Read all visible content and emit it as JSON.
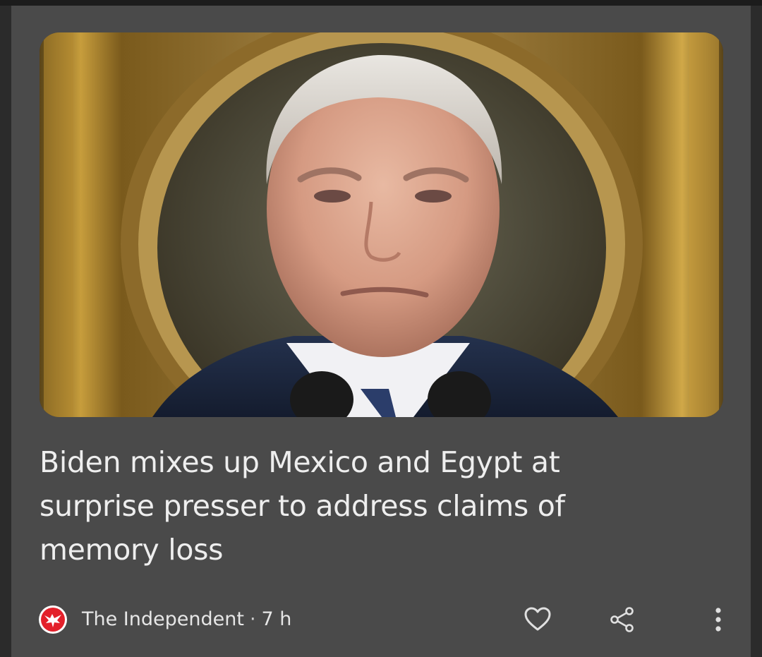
{
  "article": {
    "headline": "Biden mixes up Mexico and Egypt at surprise presser to address claims of memory loss",
    "source": "The Independent",
    "separator": "·",
    "age": "7 h"
  },
  "icons": {
    "source_logo": "the-independent-eagle-logo",
    "like": "heart-outline-icon",
    "share": "share-icon",
    "more": "more-vertical-icon"
  },
  "colors": {
    "card_background": "#4a4a4a",
    "page_background": "#2b2b2b",
    "headline_text": "#eeeeee",
    "meta_text": "#e6e6e6",
    "logo_red": "#e3202a"
  }
}
